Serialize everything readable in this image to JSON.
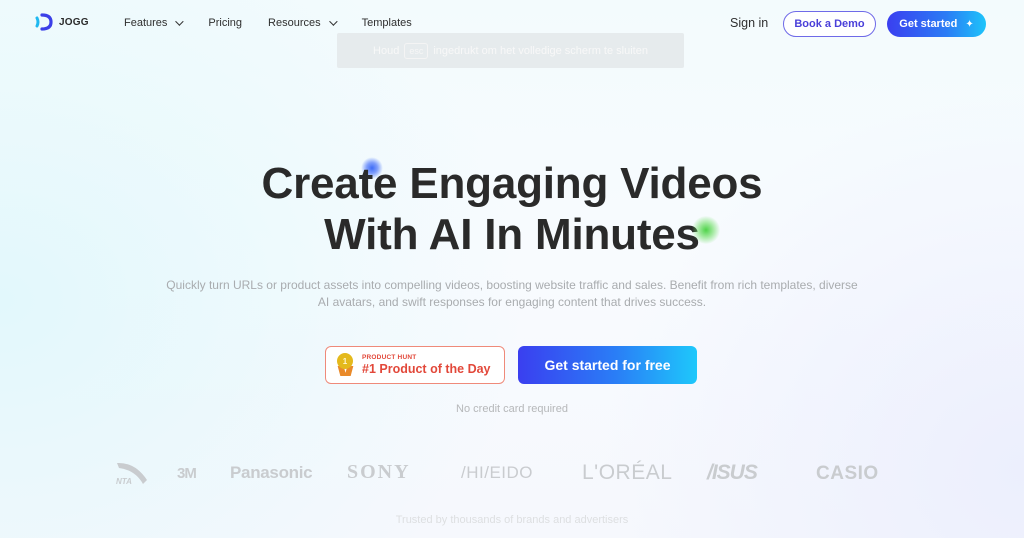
{
  "header": {
    "logo_text": "JOGG",
    "nav": [
      {
        "label": "Features",
        "has_dropdown": true
      },
      {
        "label": "Pricing",
        "has_dropdown": false
      },
      {
        "label": "Resources",
        "has_dropdown": true
      },
      {
        "label": "Templates",
        "has_dropdown": false
      }
    ],
    "sign_in": "Sign in",
    "book_demo": "Book a Demo",
    "get_started": "Get started",
    "get_started_icon": "sparkle-icon"
  },
  "toast": {
    "prefix": "Houd",
    "key": "esc",
    "suffix": "ingedrukt om het volledige scherm te sluiten"
  },
  "hero": {
    "title_line1": "Create Engaging Videos",
    "title_line2": "With AI In Minutes",
    "subtitle_line1": "Quickly turn URLs or product assets into compelling videos, boosting website traffic and sales. Benefit from rich templates, diverse",
    "subtitle_line2": "AI avatars, and swift responses for engaging content that drives success.",
    "badge": {
      "medal_number": "1",
      "small": "PRODUCT HUNT",
      "big": "#1 Product of the Day"
    },
    "cta": "Get started for free",
    "note": "No credit card required"
  },
  "brands": {
    "items": [
      "ANTA",
      "3M",
      "Panasonic",
      "SONY",
      "SHISEIDO",
      "L'ORÉAL",
      "ASUS",
      "CASIO"
    ],
    "display": {
      "anta": "NTA",
      "m3": "3M",
      "panasonic": "Panasonic",
      "sony": "SONY",
      "shiseido": "/HI/EIDO",
      "loreal": "L'ORÉAL",
      "asus": "/ISUS",
      "casio": "CASIO"
    },
    "caption": "Trusted by thousands of brands and advertisers"
  },
  "colors": {
    "primary_gradient_start": "#3a3ff0",
    "primary_gradient_end": "#1ec8fb",
    "badge_red": "#e2483a",
    "demo_border": "#6f6ae8"
  }
}
